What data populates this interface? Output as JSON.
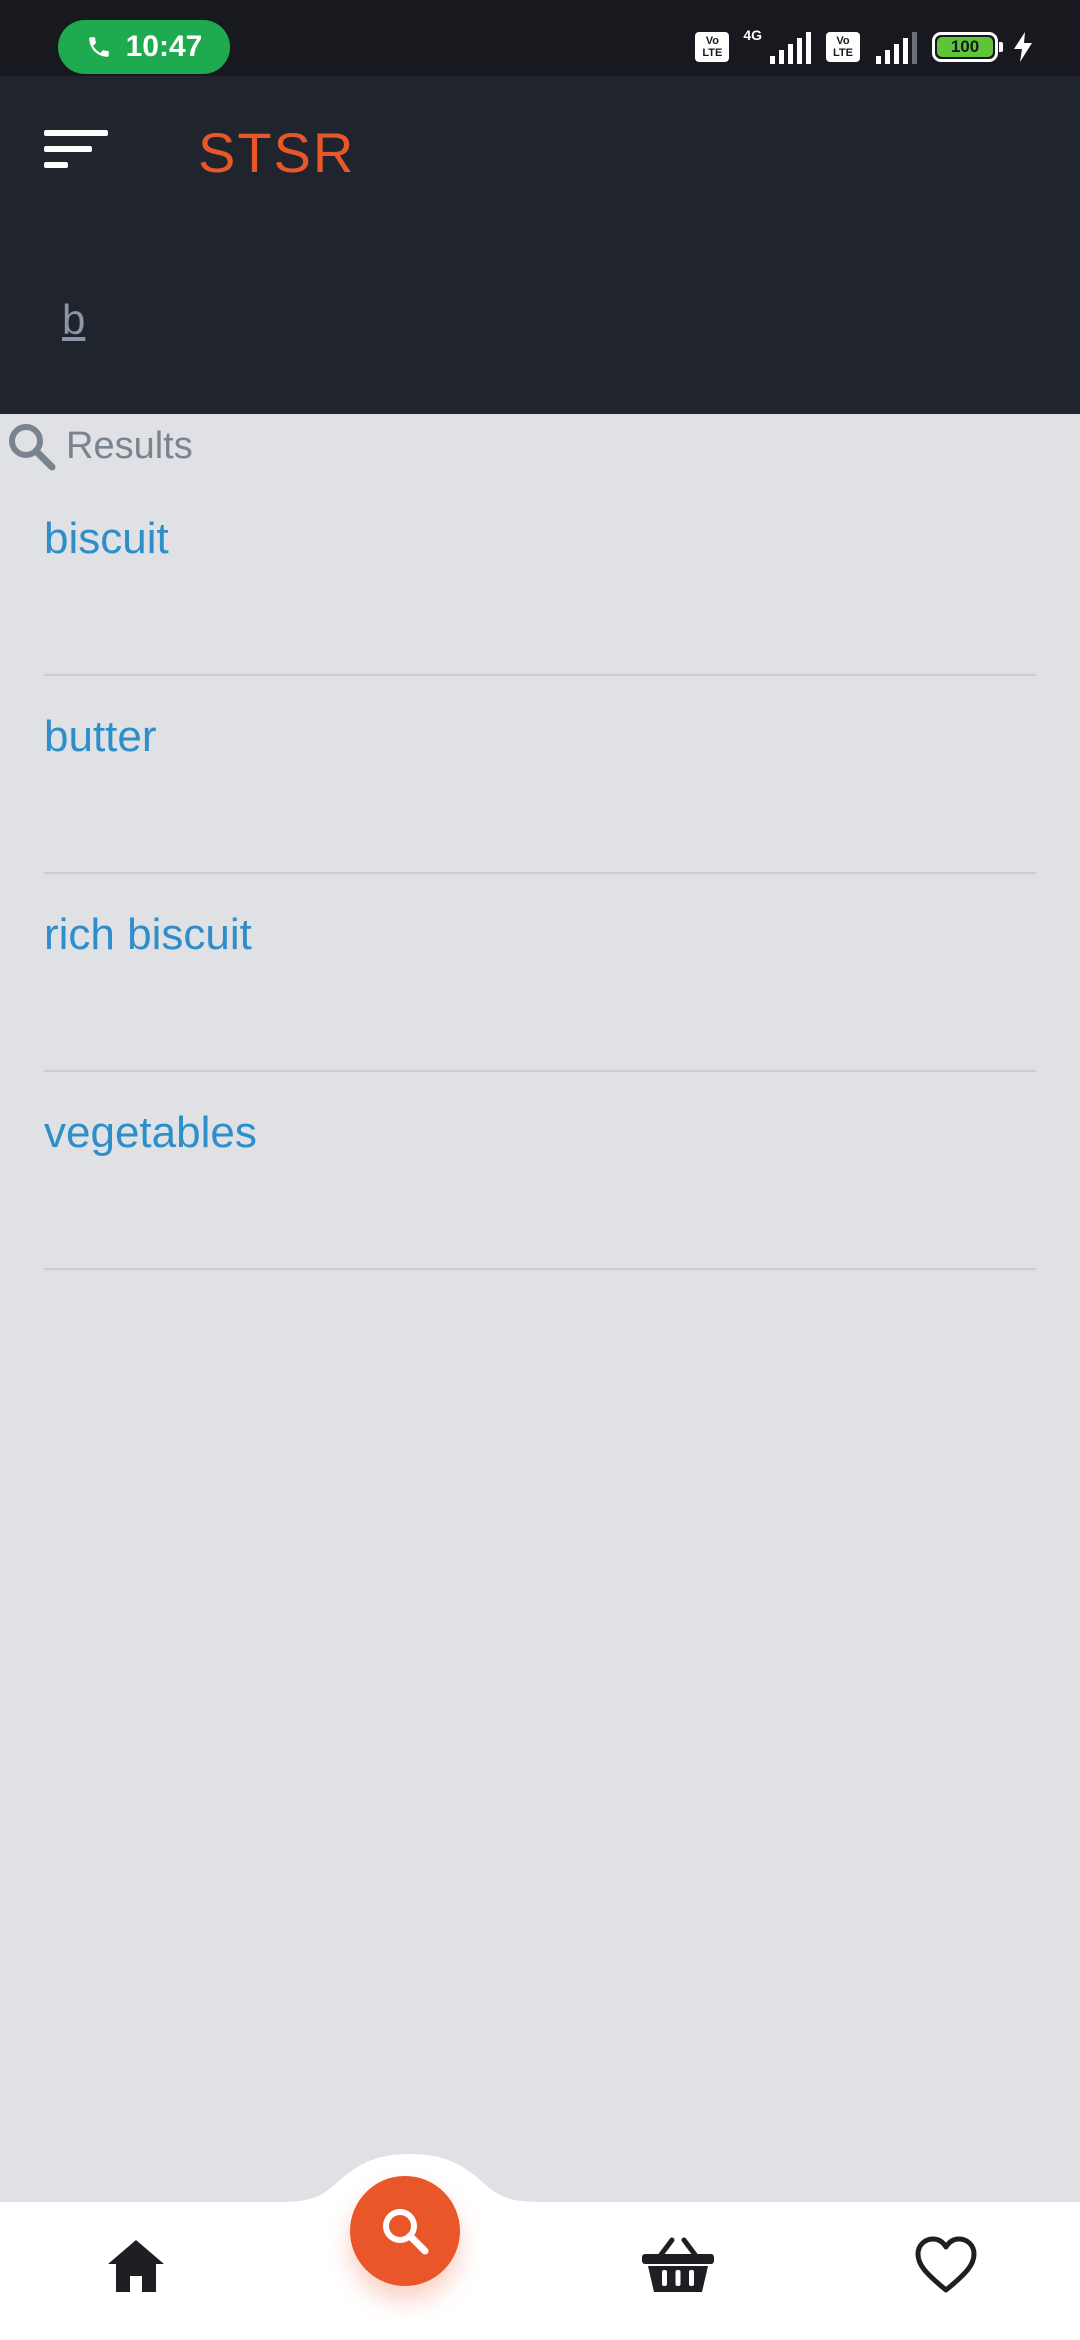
{
  "status_bar": {
    "time": "10:47",
    "network_label": "4G",
    "volte_label": "Vo LTE",
    "battery_level": "100",
    "icons": [
      "phone-icon",
      "volte-icon",
      "signal-icon",
      "battery-icon",
      "charging-icon"
    ]
  },
  "header": {
    "title": "STSR",
    "search_query": "b",
    "menu_icon": "menu-icon"
  },
  "results": {
    "heading": "Results",
    "items": [
      {
        "label": "biscuit"
      },
      {
        "label": "butter"
      },
      {
        "label": "rich biscuit"
      },
      {
        "label": "vegetables"
      }
    ]
  },
  "bottom_nav": {
    "items": [
      "home-icon",
      "search-icon",
      "basket-icon",
      "heart-icon"
    ],
    "active": "search-icon"
  },
  "colors": {
    "accent": "#e8562a",
    "header_bg": "#20242c",
    "link": "#2d8ec9",
    "page_bg": "#e0e1e4"
  }
}
